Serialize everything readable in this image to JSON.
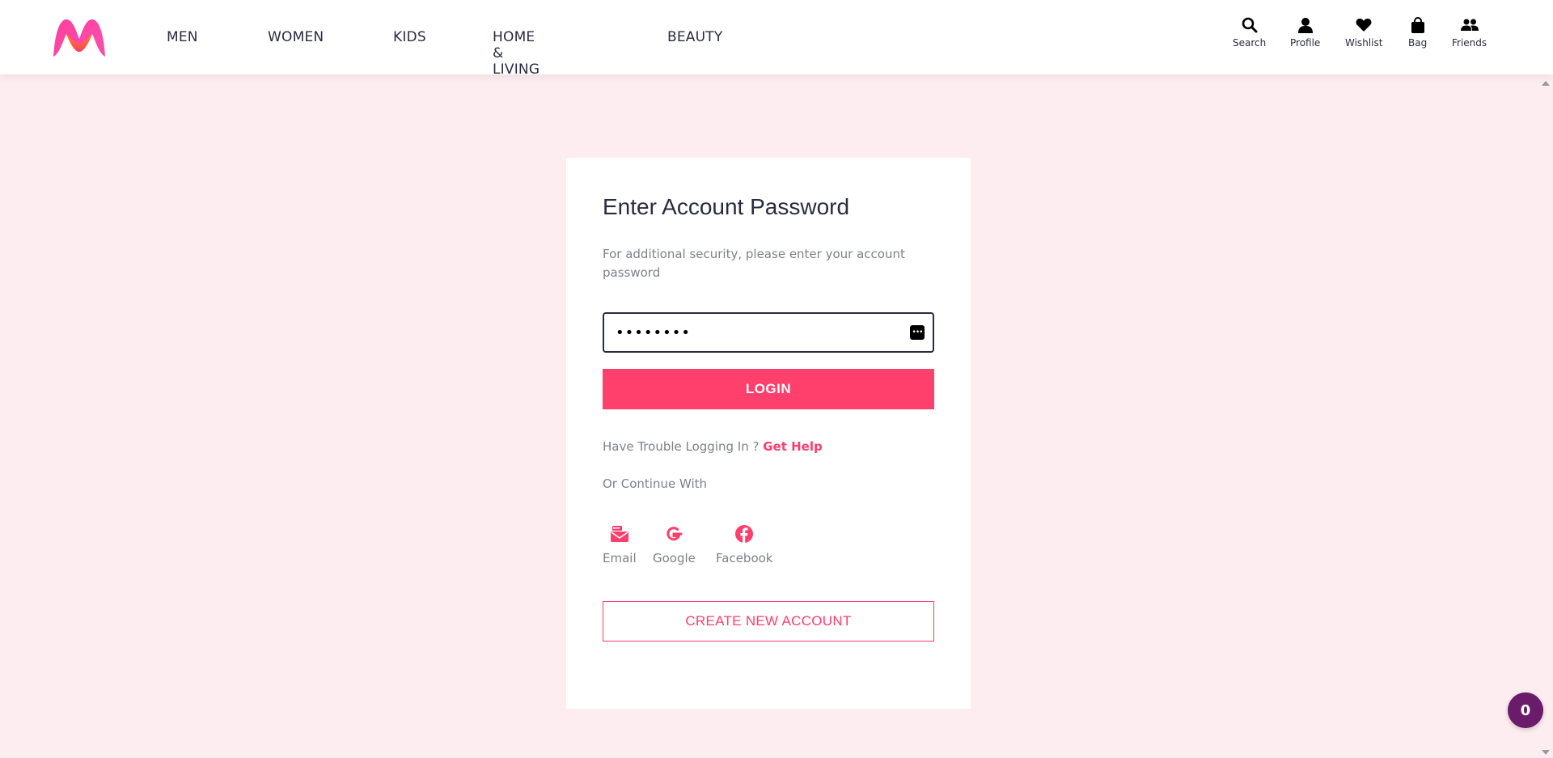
{
  "header": {
    "nav": [
      {
        "label": "MEN"
      },
      {
        "label": "WOMEN"
      },
      {
        "label": "KIDS"
      },
      {
        "label": "HOME & LIVING"
      },
      {
        "label": "BEAUTY"
      }
    ],
    "actions": [
      {
        "label": "Search",
        "icon": "search-icon"
      },
      {
        "label": "Profile",
        "icon": "profile-icon"
      },
      {
        "label": "Wishlist",
        "icon": "heart-icon"
      },
      {
        "label": "Bag",
        "icon": "bag-icon"
      },
      {
        "label": "Friends",
        "icon": "friends-icon"
      }
    ]
  },
  "card": {
    "title": "Enter Account Password",
    "subtitle": "For additional security, please enter your account password",
    "password_value": "••••••••",
    "login_label": "LOGIN",
    "help_text": "Have Trouble Logging In ?",
    "help_link": "Get Help",
    "continue_text": "Or Continue With",
    "socials": [
      {
        "label": "Email",
        "icon": "email-icon"
      },
      {
        "label": "Google",
        "icon": "google-icon"
      },
      {
        "label": "Facebook",
        "icon": "facebook-icon"
      }
    ],
    "create_label": "CREATE NEW ACCOUNT"
  },
  "chat_badge": {
    "count": "0"
  },
  "colors": {
    "brand_pink": "#ff3f6c",
    "page_bg": "#fdedf1",
    "text_dark": "#282c3f",
    "text_muted": "#7e818c",
    "badge_purple": "#6a1b6a"
  }
}
